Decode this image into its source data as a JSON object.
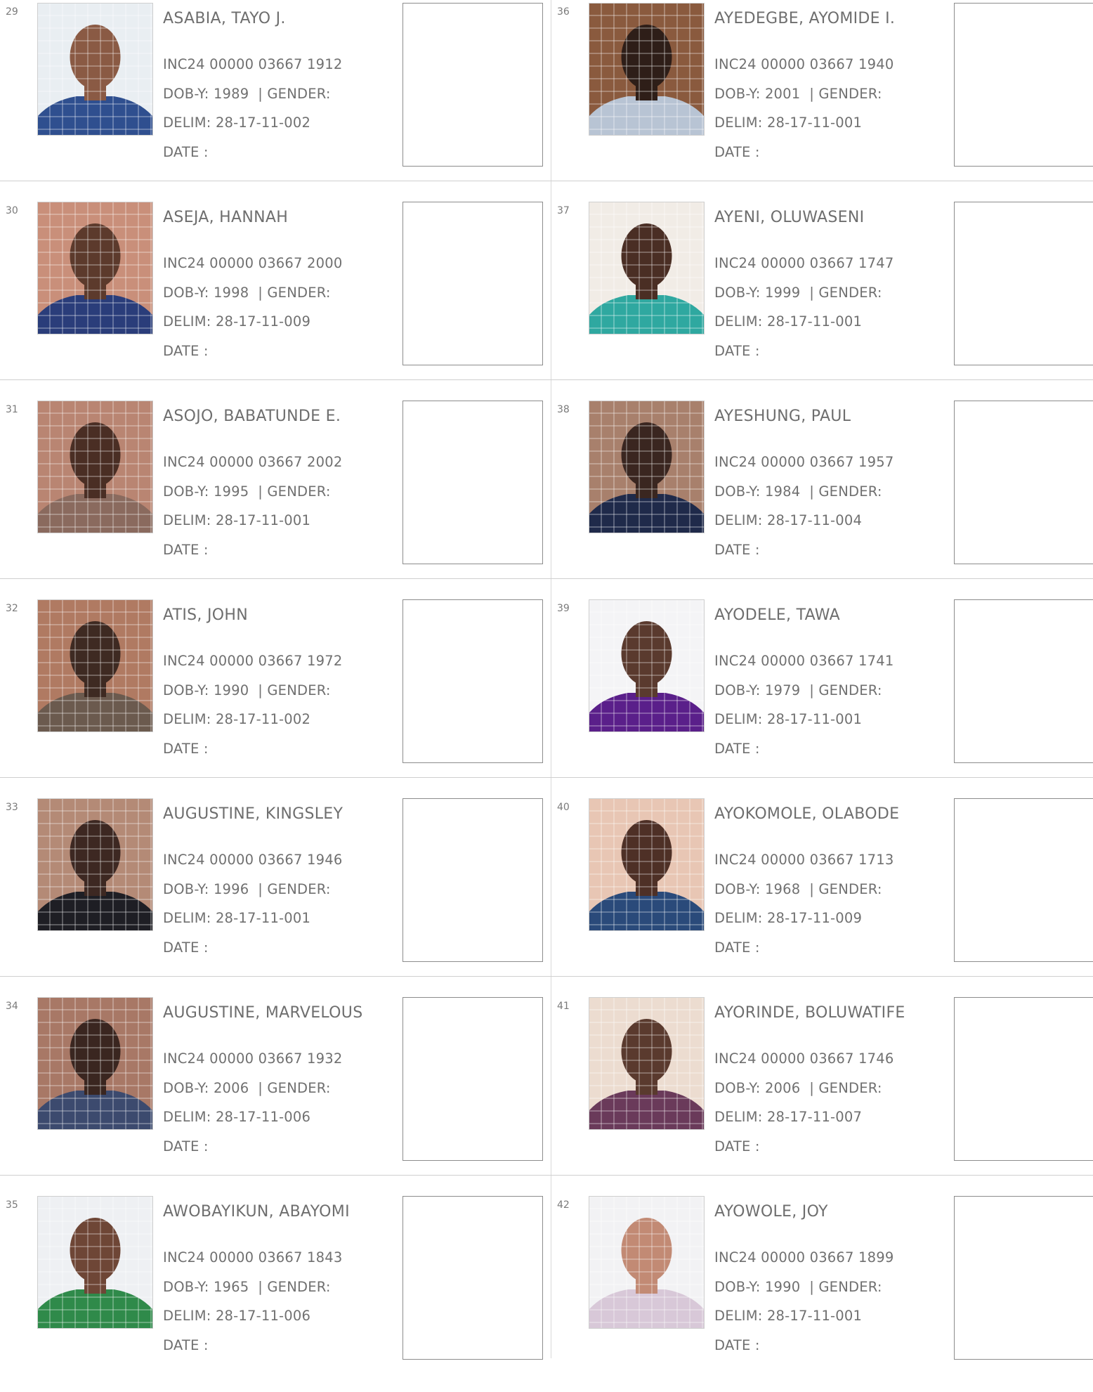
{
  "records": [
    {
      "serial": "29",
      "name": "ASABIA, TAYO J.",
      "inc": "INC24 00000 03667 1912",
      "dob": "DOB-Y: 1989",
      "gender": "| GENDER:",
      "delim": "DELIM: 28-17-11-002",
      "date": "DATE  :",
      "photo": {
        "bg": "#e9eef2",
        "skin": "#8a5a44",
        "cloth": "#2f4f8f"
      }
    },
    {
      "serial": "30",
      "name": "ASEJA, HANNAH",
      "inc": "INC24 00000 03667 2000",
      "dob": "DOB-Y: 1998",
      "gender": "| GENDER:",
      "delim": "DELIM: 28-17-11-009",
      "date": "DATE  :",
      "photo": {
        "bg": "#c98f7a",
        "skin": "#5c3a2c",
        "cloth": "#2a3d7a"
      }
    },
    {
      "serial": "31",
      "name": "ASOJO, BABATUNDE E.",
      "inc": "INC24 00000 03667 2002",
      "dob": "DOB-Y: 1995",
      "gender": "| GENDER:",
      "delim": "DELIM: 28-17-11-001",
      "date": "DATE  :",
      "photo": {
        "bg": "#b98572",
        "skin": "#4a2e24",
        "cloth": "#8a6a5e"
      }
    },
    {
      "serial": "32",
      "name": "ATIS, JOHN",
      "inc": "INC24 00000 03667 1972",
      "dob": "DOB-Y: 1990",
      "gender": "| GENDER:",
      "delim": "DELIM: 28-17-11-002",
      "date": "DATE  :",
      "photo": {
        "bg": "#b07a62",
        "skin": "#3e2a22",
        "cloth": "#6b5a4e"
      }
    },
    {
      "serial": "33",
      "name": "AUGUSTINE, KINGSLEY",
      "inc": "INC24 00000 03667 1946",
      "dob": "DOB-Y: 1996",
      "gender": "| GENDER:",
      "delim": "DELIM: 28-17-11-001",
      "date": "DATE  :",
      "photo": {
        "bg": "#b48a76",
        "skin": "#3d2822",
        "cloth": "#1e1e24"
      }
    },
    {
      "serial": "34",
      "name": "AUGUSTINE, MARVELOUS",
      "inc": "INC24 00000 03667 1932",
      "dob": "DOB-Y: 2006",
      "gender": "| GENDER:",
      "delim": "DELIM: 28-17-11-006",
      "date": "DATE  :",
      "photo": {
        "bg": "#a87866",
        "skin": "#3a2620",
        "cloth": "#3c4a6e"
      }
    },
    {
      "serial": "35",
      "name": "AWOBAYIKUN, ABAYOMI",
      "inc": "INC24 00000 03667 1843",
      "dob": "DOB-Y: 1965",
      "gender": "| GENDER:",
      "delim": "DELIM: 28-17-11-006",
      "date": "DATE  :",
      "photo": {
        "bg": "#eef0f3",
        "skin": "#6e4636",
        "cloth": "#2f8a4a"
      }
    },
    {
      "serial": "36",
      "name": "AYEDEGBE, AYOMIDE I.",
      "inc": "INC24 00000 03667 1940",
      "dob": "DOB-Y: 2001",
      "gender": "| GENDER:",
      "delim": "DELIM: 28-17-11-001",
      "date": "DATE  :",
      "photo": {
        "bg": "#8a5a3e",
        "skin": "#2e1e18",
        "cloth": "#b8c4d4"
      }
    },
    {
      "serial": "37",
      "name": "AYENI, OLUWASENI",
      "inc": "INC24 00000 03667 1747",
      "dob": "DOB-Y: 1999",
      "gender": "| GENDER:",
      "delim": "DELIM: 28-17-11-001",
      "date": "DATE  :",
      "photo": {
        "bg": "#f1ece6",
        "skin": "#4a2e24",
        "cloth": "#2fa8a0"
      }
    },
    {
      "serial": "38",
      "name": "AYESHUNG, PAUL",
      "inc": "INC24 00000 03667 1957",
      "dob": "DOB-Y: 1984",
      "gender": "| GENDER:",
      "delim": "DELIM: 28-17-11-004",
      "date": "DATE  :",
      "photo": {
        "bg": "#a8806c",
        "skin": "#3a2620",
        "cloth": "#1f2a4a"
      }
    },
    {
      "serial": "39",
      "name": "AYODELE, TAWA",
      "inc": "INC24 00000 03667 1741",
      "dob": "DOB-Y: 1979",
      "gender": "| GENDER:",
      "delim": "DELIM: 28-17-11-001",
      "date": "DATE  :",
      "photo": {
        "bg": "#f4f4f6",
        "skin": "#5a3a2e",
        "cloth": "#5a1f8a"
      }
    },
    {
      "serial": "40",
      "name": "AYOKOMOLE, OLABODE",
      "inc": "INC24 00000 03667 1713",
      "dob": "DOB-Y: 1968",
      "gender": "| GENDER:",
      "delim": "DELIM: 28-17-11-009",
      "date": "DATE  :",
      "photo": {
        "bg": "#e8c6b4",
        "skin": "#4e3026",
        "cloth": "#2a4a7a"
      }
    },
    {
      "serial": "41",
      "name": "AYORINDE, BOLUWATIFE",
      "inc": "INC24 00000 03667 1746",
      "dob": "DOB-Y: 2006",
      "gender": "| GENDER:",
      "delim": "DELIM: 28-17-11-007",
      "date": "DATE  :",
      "photo": {
        "bg": "#ecdcd0",
        "skin": "#5a3a2e",
        "cloth": "#6a3a5a"
      }
    },
    {
      "serial": "42",
      "name": "AYOWOLE, JOY",
      "inc": "INC24 00000 03667 1899",
      "dob": "DOB-Y: 1990",
      "gender": "| GENDER:",
      "delim": "DELIM: 28-17-11-001",
      "date": "DATE  :",
      "photo": {
        "bg": "#f2f2f4",
        "skin": "#c28a74",
        "cloth": "#d8c8d8"
      }
    }
  ]
}
